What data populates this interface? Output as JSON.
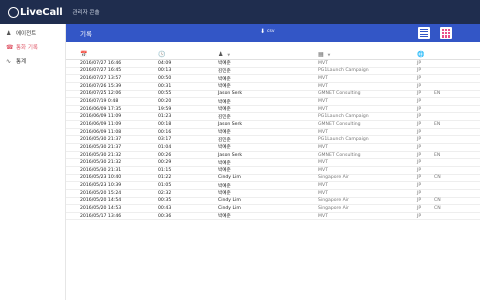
{
  "app": {
    "logo_text": "LiveCall",
    "console_title": "관리자 콘솔"
  },
  "sidebar": {
    "items": [
      {
        "label": "에이전트",
        "icon": "person-icon"
      },
      {
        "label": "통화 기록",
        "icon": "phone-icon",
        "active": true
      },
      {
        "label": "통계",
        "icon": "chart-icon"
      }
    ]
  },
  "header": {
    "title": "기록",
    "csv_label": "csv"
  },
  "table": {
    "columns": [
      "calendar-icon",
      "clock-icon",
      "person-icon",
      "building-icon",
      "globe-icon"
    ],
    "rows": [
      [
        "2016/07/27 16:46",
        "04:09",
        "박예준",
        "MVT",
        "JP",
        ""
      ],
      [
        "2016/07/27 16:45",
        "00:13",
        "김민준",
        "PG1Launch Campaign",
        "JP",
        ""
      ],
      [
        "2016/07/27 13:57",
        "00:50",
        "박예준",
        "MVT",
        "JP",
        ""
      ],
      [
        "2016/07/26 15:39",
        "00:31",
        "박예준",
        "MVT",
        "JP",
        ""
      ],
      [
        "2016/07/25 12:06",
        "00:55",
        "Jason Serk",
        "GMNET Consulting",
        "JP",
        "EN"
      ],
      [
        "2016/07/19 0:48",
        "00:20",
        "박예준",
        "MVT",
        "JP",
        ""
      ],
      [
        "2016/06/09 17:35",
        "19:59",
        "박예준",
        "MVT",
        "JP",
        ""
      ],
      [
        "2016/06/09 11:09",
        "01:23",
        "김민준",
        "PG1Launch Campaign",
        "JP",
        ""
      ],
      [
        "2016/06/09 11:09",
        "00:18",
        "Jason Serk",
        "GMNET Consulting",
        "JP",
        "EN"
      ],
      [
        "2016/06/09 11:08",
        "00:16",
        "박예준",
        "MVT",
        "JP",
        ""
      ],
      [
        "2016/05/30 21:37",
        "03:17",
        "김민준",
        "PG1Launch Campaign",
        "JP",
        ""
      ],
      [
        "2016/05/30 21:37",
        "01:04",
        "박예준",
        "MVT",
        "JP",
        ""
      ],
      [
        "2016/05/30 21:32",
        "00:26",
        "Jason Serk",
        "GMNET Consulting",
        "JP",
        "EN"
      ],
      [
        "2016/05/30 21:32",
        "00:29",
        "박예준",
        "MVT",
        "JP",
        ""
      ],
      [
        "2016/05/30 21:31",
        "01:15",
        "박예준",
        "MVT",
        "JP",
        ""
      ],
      [
        "2016/05/23 10:40",
        "01:22",
        "Cindy Lim",
        "Singapore Air",
        "JP",
        "CN"
      ],
      [
        "2016/05/23 10:39",
        "01:05",
        "박예준",
        "MVT",
        "JP",
        ""
      ],
      [
        "2016/05/20 15:24",
        "02:32",
        "박예준",
        "MVT",
        "JP",
        ""
      ],
      [
        "2016/05/20 14:54",
        "00:35",
        "Cindy Lim",
        "Singapore Air",
        "JP",
        "CN"
      ],
      [
        "2016/05/20 14:53",
        "00:43",
        "Cindy Lim",
        "Singapore Air",
        "JP",
        "CN"
      ],
      [
        "2016/05/17 13:46",
        "00:36",
        "박예준",
        "MVT",
        "JP",
        ""
      ]
    ]
  }
}
